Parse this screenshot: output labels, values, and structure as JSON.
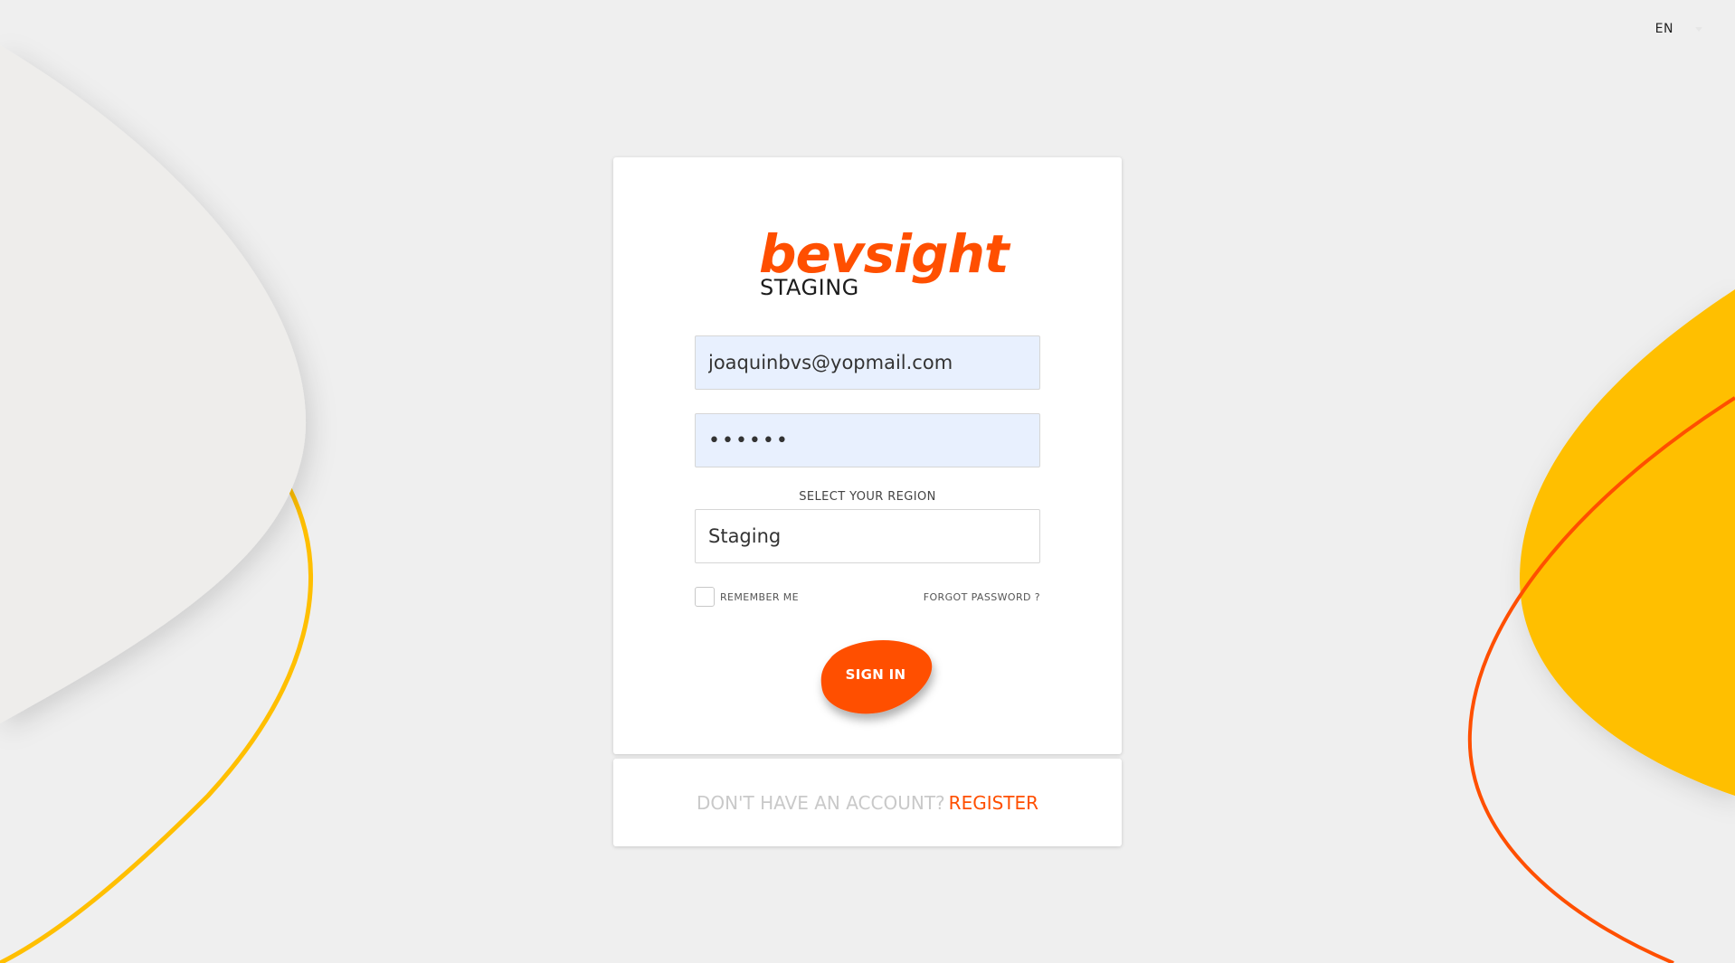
{
  "language": {
    "selected": "EN"
  },
  "brand": {
    "name": "bevsight",
    "environment": "STAGING",
    "accent_color": "#ff4f00",
    "secondary_color": "#ffbf00"
  },
  "login": {
    "email_value": "joaquinbvs@yopmail.com",
    "password_value": "••••••",
    "region_label": "SELECT YOUR REGION",
    "region_value": "Staging",
    "remember_label": "REMEMBER ME",
    "remember_checked": false,
    "forgot_label": "FORGOT PASSWORD ?",
    "signin_label": "SIGN IN"
  },
  "register": {
    "prompt": "DON'T HAVE AN ACCOUNT?",
    "link_label": "REGISTER"
  }
}
